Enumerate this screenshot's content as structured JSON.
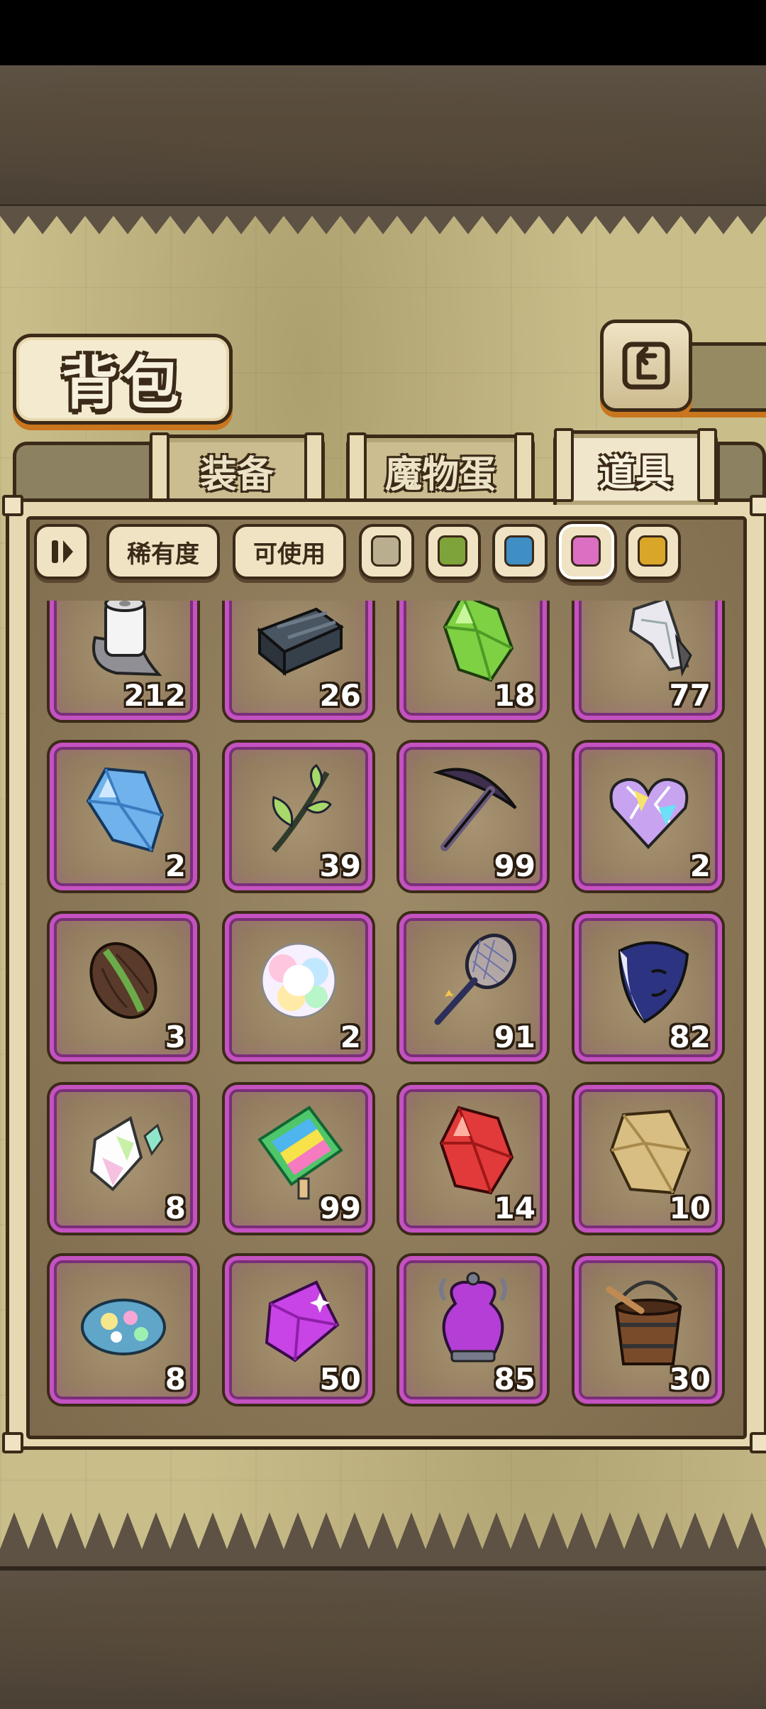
{
  "header": {
    "title": "背包"
  },
  "tabs": [
    {
      "label": "装备",
      "active": false
    },
    {
      "label": "魔物蛋",
      "active": false
    },
    {
      "label": "道具",
      "active": true
    }
  ],
  "filters": {
    "sort_icon": "pause-sort-icon",
    "rarity_label": "稀有度",
    "usable_label": "可使用",
    "rarity_colors": [
      {
        "name": "gray",
        "color": "#b9ae90"
      },
      {
        "name": "green",
        "color": "#7da33a"
      },
      {
        "name": "blue",
        "color": "#3f8ec4"
      },
      {
        "name": "pink",
        "color": "#dd6fc2"
      },
      {
        "name": "gold",
        "color": "#d9a62a"
      }
    ],
    "selected_color": "pink"
  },
  "items": [
    {
      "icon": "paper-roll-icon",
      "count": "212"
    },
    {
      "icon": "steel-bars-icon",
      "count": "26"
    },
    {
      "icon": "green-crystal-icon",
      "count": "18"
    },
    {
      "icon": "silver-shard-icon",
      "count": "77"
    },
    {
      "icon": "blue-crystal-icon",
      "count": "2"
    },
    {
      "icon": "green-sprig-icon",
      "count": "39"
    },
    {
      "icon": "pickaxe-icon",
      "count": "99"
    },
    {
      "icon": "rainbow-heart-icon",
      "count": "2"
    },
    {
      "icon": "cocoa-bean-icon",
      "count": "3"
    },
    {
      "icon": "rainbow-fluff-icon",
      "count": "2"
    },
    {
      "icon": "bug-net-icon",
      "count": "91"
    },
    {
      "icon": "moon-mask-icon",
      "count": "82"
    },
    {
      "icon": "prism-shard-icon",
      "count": "8"
    },
    {
      "icon": "rainbow-popsicle-icon",
      "count": "99"
    },
    {
      "icon": "red-crystal-icon",
      "count": "14"
    },
    {
      "icon": "gold-ore-icon",
      "count": "10"
    },
    {
      "icon": "opal-stone-icon",
      "count": "8"
    },
    {
      "icon": "purple-gem-icon",
      "count": "50"
    },
    {
      "icon": "potion-vase-icon",
      "count": "85"
    },
    {
      "icon": "wooden-bucket-icon",
      "count": "30"
    }
  ]
}
